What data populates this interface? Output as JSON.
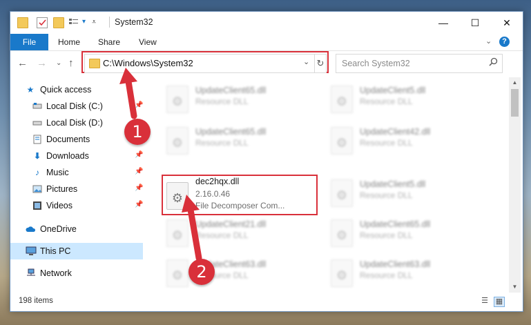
{
  "window": {
    "title": "System32",
    "controls": {
      "minimize": "—",
      "maximize": "☐",
      "close": "✕"
    }
  },
  "ribbon": {
    "tabs": [
      "File",
      "Home",
      "Share",
      "View"
    ],
    "expand_icon": "chevron-down-icon",
    "help_label": "?"
  },
  "navigation": {
    "back_icon": "back-arrow-icon",
    "forward_icon": "forward-arrow-icon",
    "recent_icon": "chevron-down-icon",
    "up_icon": "up-arrow-icon"
  },
  "address": {
    "path": "C:\\Windows\\System32",
    "dropdown_glyph": "⌄",
    "refresh_glyph": "↻"
  },
  "search": {
    "placeholder": "Search System32"
  },
  "sidebar": {
    "items": [
      {
        "label": "Quick access",
        "icon": "star-icon"
      },
      {
        "label": "Local Disk (C:)",
        "icon": "drive-icon",
        "pinned": true
      },
      {
        "label": "Local Disk (D:)",
        "icon": "drive-icon"
      },
      {
        "label": "Documents",
        "icon": "documents-icon",
        "pinned": true
      },
      {
        "label": "Downloads",
        "icon": "download-icon",
        "pinned": true
      },
      {
        "label": "Music",
        "icon": "music-icon",
        "pinned": true
      },
      {
        "label": "Pictures",
        "icon": "pictures-icon",
        "pinned": true
      },
      {
        "label": "Videos",
        "icon": "videos-icon",
        "pinned": true
      },
      {
        "label": "OneDrive",
        "icon": "cloud-icon"
      },
      {
        "label": "This PC",
        "icon": "computer-icon",
        "selected": true
      },
      {
        "label": "Network",
        "icon": "network-icon"
      }
    ]
  },
  "files": [
    {
      "name": "UpdateClient65.dll",
      "type": "Resource DLL"
    },
    {
      "name": "UpdateClient5.dll",
      "type": "Resource DLL"
    },
    {
      "name": "UpdateClient65.dll",
      "type": "Resource DLL"
    },
    {
      "name": "UpdateClient42.dll",
      "type": "Resource DLL"
    },
    {
      "name": "dec2hqx.dll",
      "version": "2.16.0.46",
      "type": "File Decomposer Com..."
    },
    {
      "name": "UpdateClient5.dll",
      "type": "Resource DLL"
    },
    {
      "name": "UpdateClient21.dll",
      "type": "Resource DLL"
    },
    {
      "name": "UpdateClient65.dll",
      "type": "Resource DLL"
    },
    {
      "name": "UpdateClient63.dll",
      "type": "Resource DLL"
    },
    {
      "name": "UpdateClient63.dll",
      "type": "Resource DLL"
    }
  ],
  "status": {
    "item_count": "198 items"
  },
  "annotations": {
    "step1": "1",
    "step2": "2",
    "highlight_color": "#d9303a"
  },
  "colors": {
    "accent": "#1979ca",
    "selection": "#cce8ff"
  }
}
